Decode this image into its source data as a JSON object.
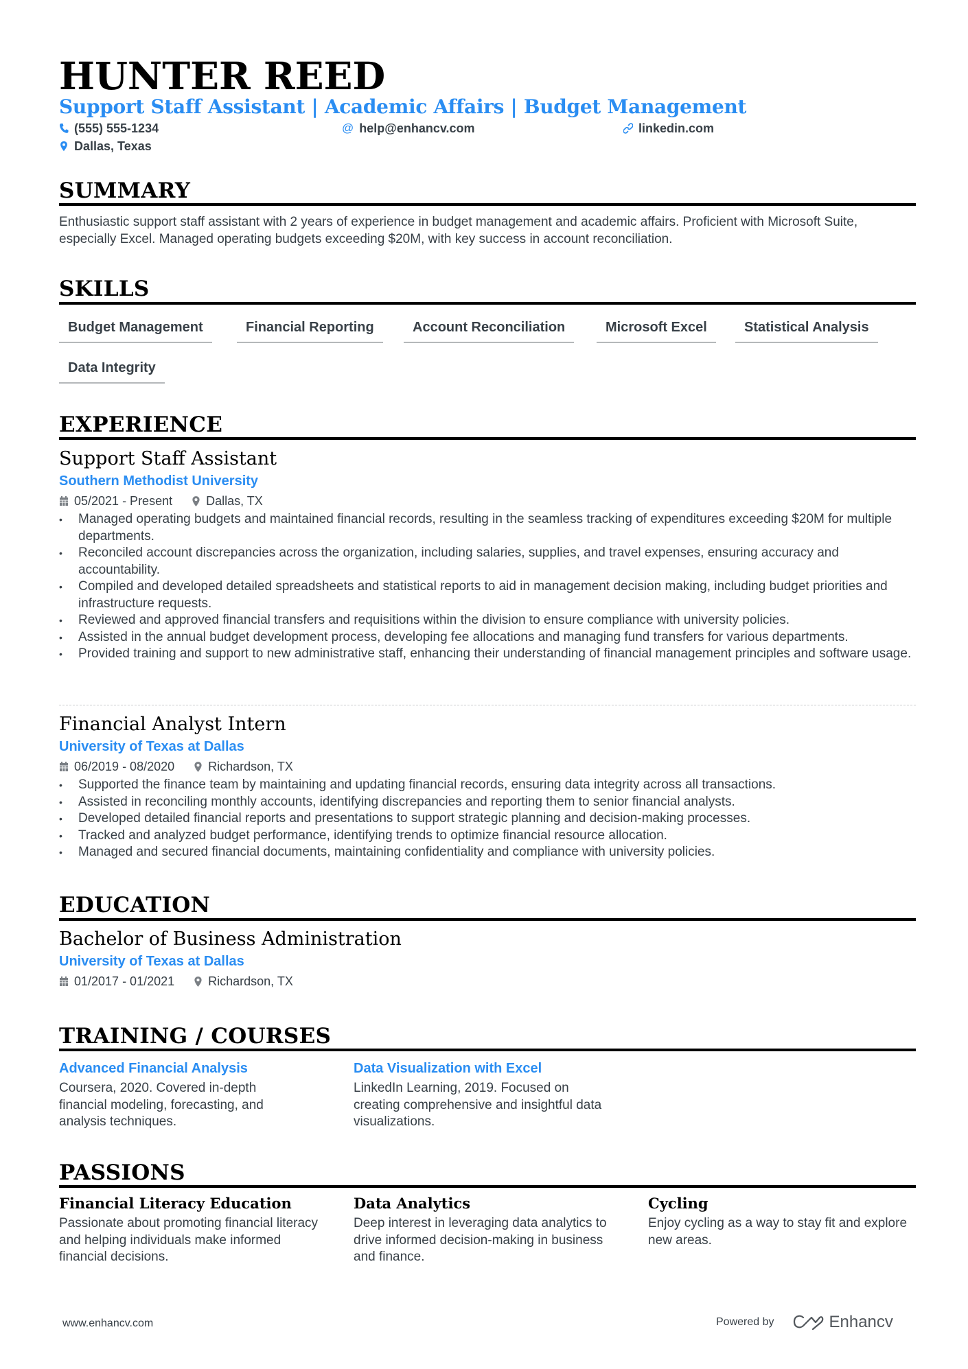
{
  "header": {
    "name": "HUNTER REED",
    "subtitle": "Support Staff Assistant | Academic Affairs | Budget Management",
    "phone": "(555) 555-1234",
    "email": "help@enhancv.com",
    "website": "linkedin.com",
    "location": "Dallas, Texas"
  },
  "summary": {
    "title": "SUMMARY",
    "text": "Enthusiastic support staff assistant with 2 years of experience in budget management and academic affairs. Proficient with Microsoft Suite, especially Excel. Managed operating budgets exceeding $20M, with key success in account reconciliation."
  },
  "skills": {
    "title": "SKILLS",
    "items": [
      "Budget Management",
      "Financial Reporting",
      "Account Reconciliation",
      "Microsoft Excel",
      "Statistical Analysis",
      "Data Integrity"
    ]
  },
  "experience": {
    "title": "EXPERIENCE",
    "jobs": [
      {
        "title": "Support Staff Assistant",
        "company": "Southern Methodist University",
        "dates": "05/2021 - Present",
        "location": "Dallas, TX",
        "bullets": [
          "Managed operating budgets and maintained financial records, resulting in the seamless tracking of expenditures exceeding $20M for multiple departments.",
          "Reconciled account discrepancies across the organization, including salaries, supplies, and travel expenses, ensuring accuracy and accountability.",
          "Compiled and developed detailed spreadsheets and statistical reports to aid in management decision making, including budget priorities and infrastructure requests.",
          "Reviewed and approved financial transfers and requisitions within the division to ensure compliance with university policies.",
          "Assisted in the annual budget development process, developing fee allocations and managing fund transfers for various departments.",
          "Provided training and support to new administrative staff, enhancing their understanding of financial management principles and software usage."
        ]
      },
      {
        "title": "Financial Analyst Intern",
        "company": "University of Texas at Dallas",
        "dates": "06/2019 - 08/2020",
        "location": "Richardson, TX",
        "bullets": [
          "Supported the finance team by maintaining and updating financial records, ensuring data integrity across all transactions.",
          "Assisted in reconciling monthly accounts, identifying discrepancies and reporting them to senior financial analysts.",
          "Developed detailed financial reports and presentations to support strategic planning and decision-making processes.",
          "Tracked and analyzed budget performance, identifying trends to optimize financial resource allocation.",
          "Managed and secured financial documents, maintaining confidentiality and compliance with university policies."
        ]
      }
    ]
  },
  "education": {
    "title": "EDUCATION",
    "degree": "Bachelor of Business Administration",
    "school": "University of Texas at Dallas",
    "dates": "01/2017 - 01/2021",
    "location": "Richardson, TX"
  },
  "training": {
    "title": "TRAINING / COURSES",
    "items": [
      {
        "title": "Advanced Financial Analysis",
        "text": "Coursera, 2020. Covered in-depth financial modeling, forecasting, and analysis techniques."
      },
      {
        "title": "Data Visualization with Excel",
        "text": "LinkedIn Learning, 2019. Focused on creating comprehensive and insightful data visualizations."
      }
    ]
  },
  "passions": {
    "title": "PASSIONS",
    "items": [
      {
        "title": "Financial Literacy Education",
        "text": "Passionate about promoting financial literacy and helping individuals make informed financial decisions."
      },
      {
        "title": "Data Analytics",
        "text": "Deep interest in leveraging data analytics to drive informed decision-making in business and finance."
      },
      {
        "title": "Cycling",
        "text": "Enjoy cycling as a way to stay fit and explore new areas."
      }
    ]
  },
  "footer": {
    "website": "www.enhancv.com",
    "powered_by": "Powered by",
    "brand": "Enhancv"
  },
  "colors": {
    "accent": "#2a8df2",
    "text": "#384047",
    "heading": "#000000"
  }
}
